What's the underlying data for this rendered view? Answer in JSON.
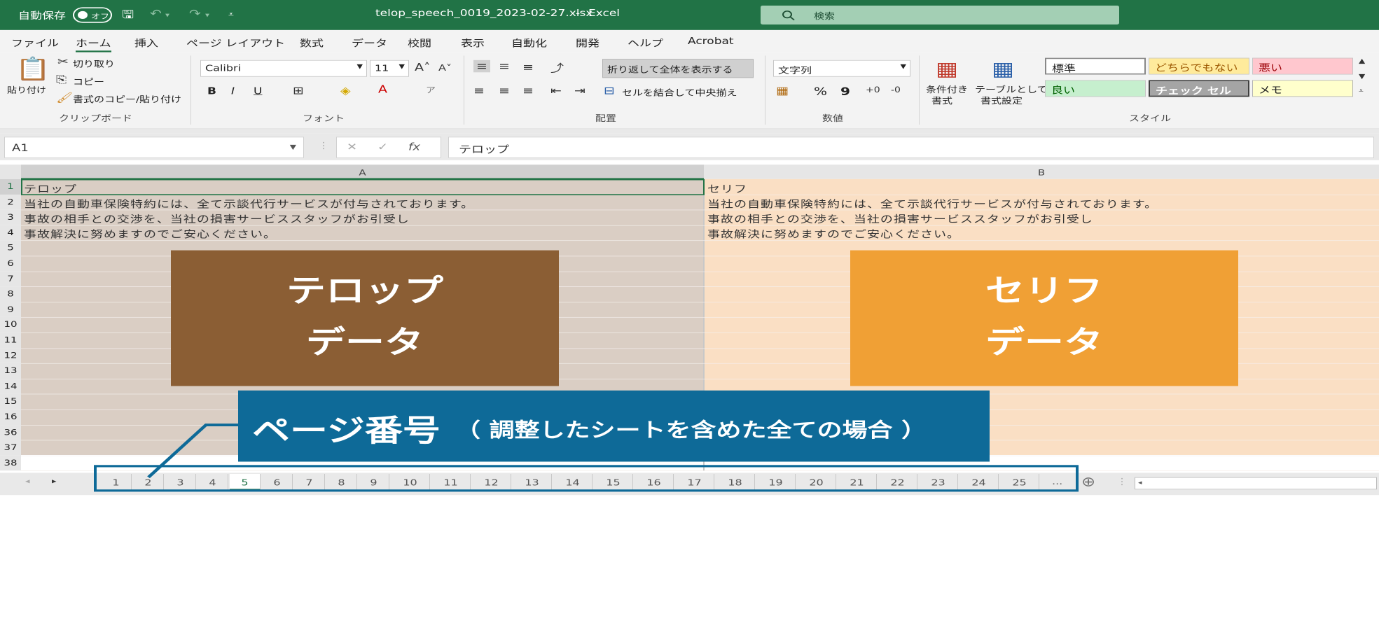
{
  "titlebar": {
    "autosave_label": "自動保存",
    "autosave_state": "オフ",
    "filename": "telop_speech_0019_2023-02-27.xlsx",
    "separator": "-",
    "app_name": "Excel",
    "search_placeholder": "検索"
  },
  "menu": [
    "ファイル",
    "ホーム",
    "挿入",
    "ページ レイアウト",
    "数式",
    "データ",
    "校閲",
    "表示",
    "自動化",
    "開発",
    "ヘルプ",
    "Acrobat"
  ],
  "ribbon": {
    "clipboard": {
      "paste": "貼り付け",
      "cut": "切り取り",
      "copy": "コピー",
      "format_painter": "書式のコピー/貼り付け",
      "label": "クリップボード"
    },
    "font": {
      "family": "Calibri",
      "size": "11",
      "bold": "B",
      "italic": "I",
      "underline": "U",
      "label": "フォント"
    },
    "alignment": {
      "wrap_text": "折り返して全体を表示する",
      "merge_center": "セルを結合して中央揃え",
      "label": "配置"
    },
    "number": {
      "format": "文字列",
      "percent": "%",
      "comma": "9",
      "label": "数値"
    },
    "styles": {
      "conditional": "条件付き",
      "conditional2": "書式",
      "as_table": "テーブルとして",
      "as_table2": "書式設定",
      "cells": [
        {
          "label": "標準",
          "bg": "#ffffff",
          "fg": "#000000"
        },
        {
          "label": "どちらでもない",
          "bg": "#ffeb9c",
          "fg": "#9c5700"
        },
        {
          "label": "悪い",
          "bg": "#ffc7ce",
          "fg": "#9c0006"
        },
        {
          "label": "良い",
          "bg": "#c6efce",
          "fg": "#006100"
        },
        {
          "label": "チェック セル",
          "bg": "#a5a5a5",
          "fg": "#ffffff"
        },
        {
          "label": "メモ",
          "bg": "#ffffcc",
          "fg": "#000000"
        }
      ],
      "label": "スタイル"
    }
  },
  "formula_bar": {
    "name_box": "A1",
    "cancel": "✕",
    "enter": "✓",
    "fx": "fx",
    "content": "テロップ"
  },
  "sheet": {
    "col_a": "A",
    "col_b": "B",
    "row_numbers": [
      "1",
      "2",
      "3",
      "4",
      "5",
      "6",
      "7",
      "8",
      "9",
      "10",
      "11",
      "12",
      "13",
      "14",
      "15",
      "16",
      "36",
      "37",
      "38"
    ],
    "col_a_cells": [
      "テロップ",
      "当社の自動車保険特約には、全て示談代行サービスが付与されております。",
      "事故の相手との交渉を、当社の損害サービススタッフがお引受し",
      "事故解決に努めますのでご安心ください。"
    ],
    "col_b_cells": [
      "セリフ",
      "当社の自動車保険特約には、全て示談代行サービスが付与されております。",
      "事故の相手との交渉を、当社の損害サービススタッフがお引受し",
      "事故解決に努めますのでご安心ください。"
    ]
  },
  "overlay": {
    "telop_line1": "テロップ",
    "telop_line2": "データ",
    "serif_line1": "セリフ",
    "serif_line2": "データ",
    "callout_main": "ページ番号",
    "callout_sub": "（ 調整したシートを含めた全ての場合 ）",
    "telop_color": "#8b5e34",
    "serif_color": "#f0a035",
    "callout_color": "#0e6a98"
  },
  "tabs": {
    "items": [
      "1",
      "2",
      "3",
      "4",
      "5",
      "6",
      "7",
      "8",
      "9",
      "10",
      "11",
      "12",
      "13",
      "14",
      "15",
      "16",
      "17",
      "18",
      "19",
      "20",
      "21",
      "22",
      "23",
      "24",
      "25"
    ],
    "active": "5",
    "more": "...",
    "add": "⊕"
  }
}
